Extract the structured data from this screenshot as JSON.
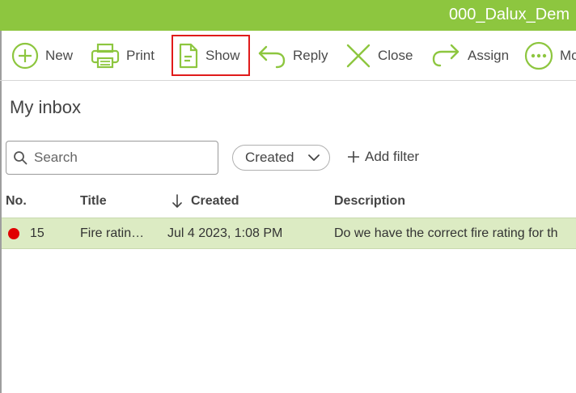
{
  "header": {
    "title": "000_Dalux_Dem"
  },
  "toolbar": {
    "new_label": "New",
    "print_label": "Print",
    "show_label": "Show",
    "reply_label": "Reply",
    "close_label": "Close",
    "assign_label": "Assign",
    "more_label": "Mo"
  },
  "page": {
    "title": "My inbox"
  },
  "search": {
    "placeholder": "Search"
  },
  "filters": {
    "sort_chip": "Created",
    "add_filter": "Add filter"
  },
  "table": {
    "columns": {
      "no": "No.",
      "title": "Title",
      "created": "Created",
      "description": "Description"
    },
    "rows": [
      {
        "no": "15",
        "title": "Fire ratin…",
        "created": "Jul 4 2023, 1:08 PM",
        "description": "Do we have the correct fire rating for th",
        "status_color": "#e00000"
      }
    ]
  },
  "colors": {
    "brand": "#8dc63f",
    "selected_row": "#dcebc3",
    "highlight_box": "#e01b1b"
  }
}
